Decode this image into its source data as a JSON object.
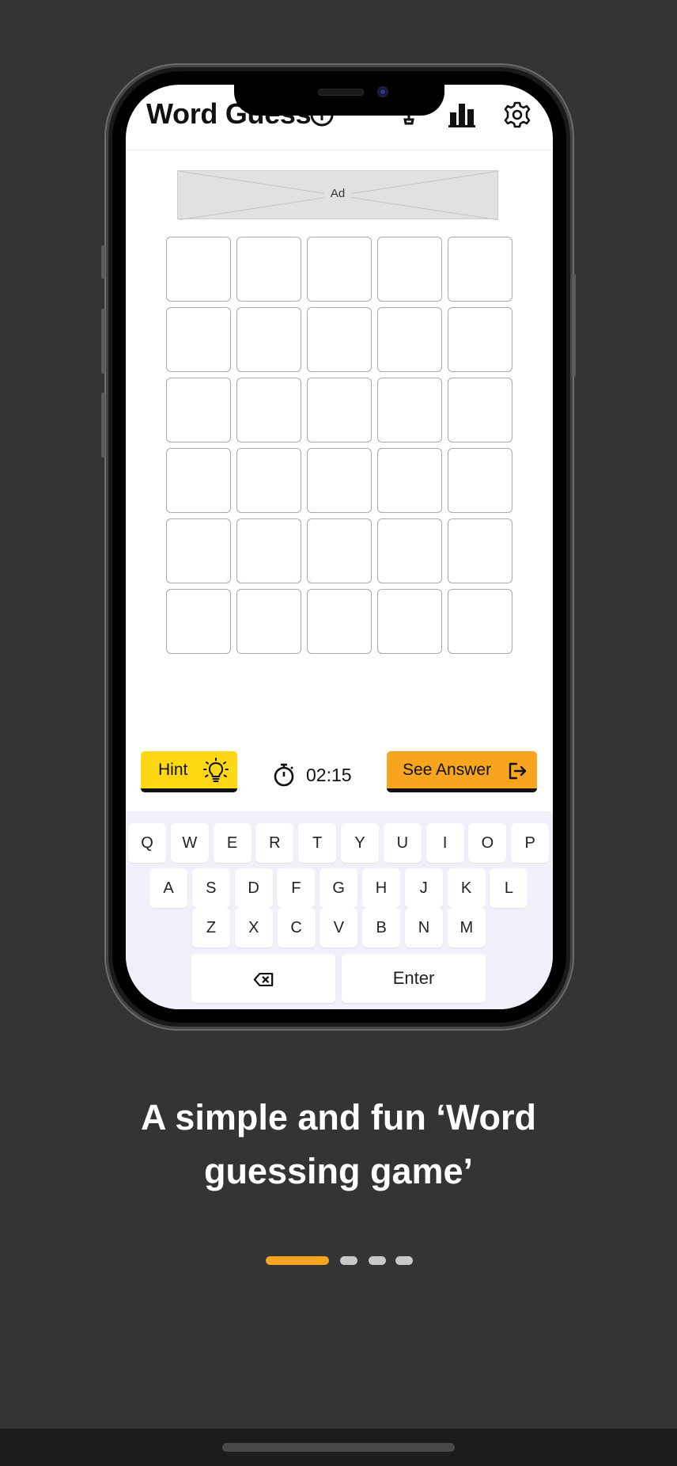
{
  "app": {
    "title": "Word Guess",
    "header_icons": [
      "info-icon",
      "trophy-icon",
      "stats-icon",
      "settings-icon"
    ]
  },
  "ad": {
    "label": "Ad"
  },
  "board": {
    "rows": 6,
    "cols": 5
  },
  "actions": {
    "hint_label": "Hint",
    "timer": "02:15",
    "answer_label": "See Answer"
  },
  "keyboard": {
    "row1": [
      "Q",
      "W",
      "E",
      "R",
      "T",
      "Y",
      "U",
      "I",
      "O",
      "P"
    ],
    "row2": [
      "A",
      "S",
      "D",
      "F",
      "G",
      "H",
      "J",
      "K",
      "L"
    ],
    "row3": [
      "Z",
      "X",
      "C",
      "V",
      "B",
      "N",
      "M"
    ],
    "enter_label": "Enter"
  },
  "caption": {
    "line1": "A simple and fun ‘Word",
    "line2": "guessing game’"
  },
  "pager": {
    "count": 4,
    "active": 0
  },
  "colors": {
    "background": "#343434",
    "hint": "#ffd815",
    "answer": "#f7a41f",
    "active_dot": "#f7a41f",
    "inactive_dot": "#c8c8c8",
    "keyboard_bg": "#f0f0fa"
  }
}
